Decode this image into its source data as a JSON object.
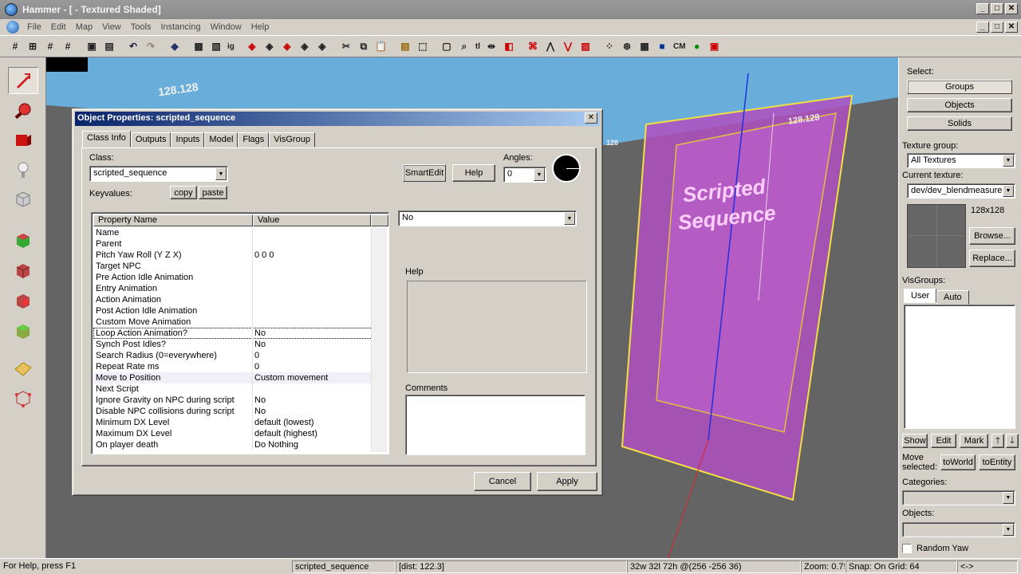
{
  "app": {
    "title": "Hammer - [ - Textured Shaded]",
    "window_controls": {
      "minimize": "_",
      "maximize": "□",
      "close": "✕"
    }
  },
  "menu": [
    "File",
    "Edit",
    "Map",
    "View",
    "Tools",
    "Instancing",
    "Window",
    "Help"
  ],
  "toolbar": {
    "icons": [
      "grid-icon",
      "grid-large-icon",
      "grid-small-icon",
      "hash-icon",
      "group-icon",
      "ungroup-icon",
      "undo-icon",
      "redo-icon",
      "carve-icon",
      "texture-lock-icon",
      "hollow-icon",
      "ig-icon",
      "solid1-icon",
      "solid2-icon",
      "solid3-icon",
      "solid4-icon",
      "cut-icon",
      "copy-icon",
      "paste-icon",
      "run-icon",
      "select-icon",
      "magnify-icon",
      "texture-app-icon",
      "mirror-icon",
      "flip-icon",
      "decal-icon",
      "vertex-icon",
      "clip-icon",
      "overlay-icon",
      "models-icon",
      "camera-icon",
      "wireframe-icon",
      "entity-icon",
      "cm-icon",
      "leaf-icon",
      "nodraw-icon"
    ],
    "text_buttons": {
      "ig": "ig",
      "cm": "CM",
      "tl": "tl"
    }
  },
  "viewport": {
    "wall_label_1": "128.128",
    "wall_label_2": "128.128",
    "wall_label_3": "128",
    "overlay_text_line1": "Scripted",
    "overlay_text_line2": "Sequence",
    "colors": {
      "entity_fill": "#b050c0",
      "entity_edge": "#f0e040",
      "axis_blue": "#2030e0",
      "axis_red": "#e02020"
    }
  },
  "dialog": {
    "title": "Object Properties: scripted_sequence",
    "close": "✕",
    "tabs": [
      "Class Info",
      "Outputs",
      "Inputs",
      "Model",
      "Flags",
      "VisGroup"
    ],
    "active_tab": "Class Info",
    "class_label": "Class:",
    "class_value": "scripted_sequence",
    "keyvalues_label": "Keyvalues:",
    "copy_label": "copy",
    "paste_label": "paste",
    "smartedit_label": "SmartEdit",
    "help_label": "Help",
    "angles_label": "Angles:",
    "angles_value": "0",
    "table_headers": [
      "Property Name",
      "Value"
    ],
    "rows": [
      {
        "name": "Name",
        "value": ""
      },
      {
        "name": "Parent",
        "value": ""
      },
      {
        "name": "Pitch Yaw Roll (Y Z X)",
        "value": "0 0 0"
      },
      {
        "name": "Target NPC",
        "value": ""
      },
      {
        "name": "Pre Action Idle Animation",
        "value": ""
      },
      {
        "name": "Entry Animation",
        "value": ""
      },
      {
        "name": "Action Animation",
        "value": ""
      },
      {
        "name": "Post Action Idle Animation",
        "value": ""
      },
      {
        "name": "Custom Move Animation",
        "value": ""
      },
      {
        "name": "Loop Action Animation?",
        "value": "No"
      },
      {
        "name": "Synch Post Idles?",
        "value": "No"
      },
      {
        "name": "Search Radius (0=everywhere)",
        "value": "0"
      },
      {
        "name": "Repeat Rate ms",
        "value": "0"
      },
      {
        "name": "Move to Position",
        "value": "Custom movement"
      },
      {
        "name": "Next Script",
        "value": ""
      },
      {
        "name": "Ignore Gravity on NPC during script",
        "value": "No"
      },
      {
        "name": "Disable NPC collisions during script",
        "value": "No"
      },
      {
        "name": "Minimum DX Level",
        "value": "default (lowest)"
      },
      {
        "name": "Maximum DX Level",
        "value": "default (highest)"
      },
      {
        "name": "On player death",
        "value": "Do Nothing"
      }
    ],
    "value_dropdown": "No",
    "help_box_label": "Help",
    "comments_label": "Comments",
    "cancel_label": "Cancel",
    "apply_label": "Apply"
  },
  "side": {
    "select_label": "Select:",
    "groups_label": "Groups",
    "objects_label": "Objects",
    "solids_label": "Solids",
    "texture_group_label": "Texture group:",
    "texture_group_value": "All Textures",
    "current_texture_label": "Current texture:",
    "current_texture_value": "dev/dev_blendmeasure",
    "texture_size": "128x128",
    "browse_label": "Browse...",
    "replace_label": "Replace...",
    "visgroups_label": "VisGroups:",
    "user_tab": "User",
    "auto_tab": "Auto",
    "show_label": "Show",
    "edit_label": "Edit",
    "mark_label": "Mark",
    "up_label": "🡑",
    "down_label": "🡓",
    "move_selected_label": "Move selected:",
    "toworld_label": "toWorld",
    "toentity_label": "toEntity",
    "categories_label": "Categories:",
    "objects_list_label": "Objects:",
    "random_yaw_label": "Random Yaw"
  },
  "status": {
    "help": "For Help, press F1",
    "selection": "scripted_sequence",
    "dist": "[dist: 122.3]",
    "size": "32w 32l 72h @(256 -256 36)",
    "zoom": "Zoom: 0.75",
    "snap": "Snap: On Grid: 64",
    "arrows": "<->"
  }
}
